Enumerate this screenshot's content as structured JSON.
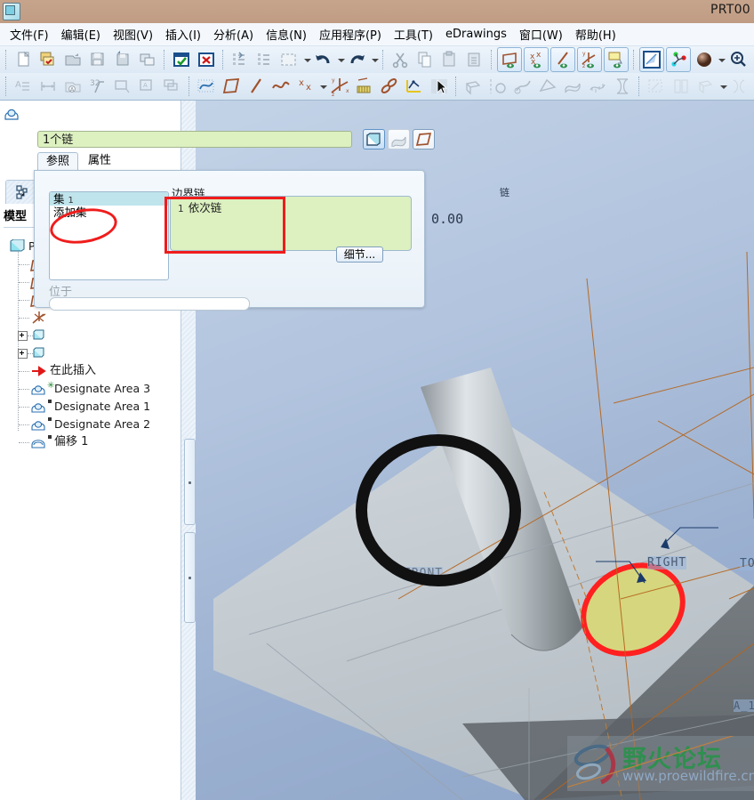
{
  "window": {
    "title": "PRT00",
    "app_icon": "part-document-icon"
  },
  "menubar": {
    "items": [
      {
        "label": "文件(F)",
        "name": "menu-file"
      },
      {
        "label": "编辑(E)",
        "name": "menu-edit"
      },
      {
        "label": "视图(V)",
        "name": "menu-view"
      },
      {
        "label": "插入(I)",
        "name": "menu-insert"
      },
      {
        "label": "分析(A)",
        "name": "menu-analysis"
      },
      {
        "label": "信息(N)",
        "name": "menu-info"
      },
      {
        "label": "应用程序(P)",
        "name": "menu-applications"
      },
      {
        "label": "工具(T)",
        "name": "menu-tools"
      },
      {
        "label": "eDrawings",
        "name": "menu-edrawings"
      },
      {
        "label": "窗口(W)",
        "name": "menu-window"
      },
      {
        "label": "帮助(H)",
        "name": "menu-help"
      }
    ]
  },
  "toolbar_row1": {
    "icons": [
      "new-file-icon",
      "open-recent-icon",
      "open-folder-icon",
      "save-icon",
      "save-a-copy-icon",
      "copy-window-icon",
      "accept-check-icon",
      "cancel-x-icon",
      "regenerate-icon",
      "regenerate-all-icon",
      "selection-box-icon",
      "undo-icon",
      "redo-icon",
      "cut-icon",
      "copy-icon",
      "paste-icon",
      "paste-special-icon",
      "datum-plane-icon",
      "datum-point-icon",
      "datum-axis-icon",
      "datum-csys-icon",
      "annotation-icon",
      "spin-center-icon",
      "named-view-icon",
      "appearance-sphere-icon",
      "zoom-in-icon"
    ]
  },
  "toolbar_row2": {
    "icons": [
      "text-style-icon",
      "dimension-icon",
      "view-note-icon",
      "tolerance-32-icon",
      "layer-icon",
      "layer-props-icon",
      "layer-copy-icon",
      "sketch-curve-icon",
      "plane-brown-icon",
      "axis-brown-icon",
      "curve-brown-icon",
      "point-brown-icon",
      "csys-brown-icon",
      "graph-icon",
      "chain-link-icon",
      "curve-yellow-icon",
      "pointer-icon",
      "extrude-icon",
      "revolve-icon",
      "sweep-icon",
      "blend-icon",
      "surface-icon",
      "mesh-icon",
      "shell-icon",
      "draft-icon",
      "rib-icon",
      "pattern-icon",
      "mirror-icon"
    ]
  },
  "model_tree": {
    "panel_tab_icon": "model-tree-icon",
    "title": "模型",
    "root": "PR",
    "nodes": [
      {
        "label": "",
        "icon": "datum-plane-icon",
        "indent": 1
      },
      {
        "label": "",
        "icon": "datum-plane-icon",
        "indent": 1
      },
      {
        "label": "",
        "icon": "datum-plane-icon",
        "indent": 1
      },
      {
        "label": "",
        "icon": "datum-csys-icon",
        "indent": 1
      },
      {
        "label": "",
        "icon": "solid-feature-icon",
        "indent": 1,
        "expandable": true
      },
      {
        "label": "",
        "icon": "solid-feature-icon",
        "indent": 1,
        "expandable": true
      },
      {
        "label": "在此插入",
        "icon": "insert-here-arrow-icon",
        "indent": 1
      },
      {
        "label": "Designate Area 3",
        "icon": "designate-area-icon",
        "indent": 1,
        "marker": "asterisk"
      },
      {
        "label": "Designate Area 1",
        "icon": "designate-area-icon",
        "indent": 1,
        "marker": "square"
      },
      {
        "label": "Designate Area 2",
        "icon": "designate-area-icon",
        "indent": 1,
        "marker": "square"
      },
      {
        "label": "偏移 1",
        "icon": "offset-feature-icon",
        "indent": 1,
        "marker": "square"
      }
    ]
  },
  "dashboard": {
    "chain_field_value": "1个链",
    "toggle_buttons": [
      {
        "name": "solid-surface-toggle",
        "icon": "solid-cube-icon",
        "state": "on"
      },
      {
        "name": "quilt-toggle",
        "icon": "quilt-surface-icon",
        "state": "disabled"
      },
      {
        "name": "datum-toggle",
        "icon": "plane-outline-icon",
        "state": "off"
      }
    ],
    "tabs": [
      {
        "label": "参照",
        "name": "tab-references",
        "active": true
      },
      {
        "label": "属性",
        "name": "tab-properties",
        "active": false
      }
    ],
    "set_list": {
      "rows": [
        {
          "text": "集",
          "num": "1",
          "selected": true
        },
        {
          "text": "添加集",
          "num": "",
          "selected": false
        }
      ]
    },
    "boundary_group": {
      "label": "边界链",
      "items": [
        {
          "num": "1",
          "text": "依次链"
        }
      ]
    },
    "detail_button": "细节...",
    "at_label": "位于",
    "at_value": ""
  },
  "annotations": {
    "red_marks": [
      {
        "name": "red-ellipse-add-set",
        "shape": "ellipse"
      },
      {
        "name": "red-box-boundary-chain",
        "shape": "rect"
      }
    ],
    "black_circle": {
      "name": "black-circle-highlight"
    }
  },
  "viewport": {
    "dimension_value": "0.00",
    "chain_callout": "链",
    "plane_labels": [
      {
        "text": "RIGHT",
        "name": "plane-label-right"
      },
      {
        "text": "FRONT",
        "name": "plane-label-front"
      },
      {
        "text": "A_1",
        "name": "axis-label-a1"
      },
      {
        "text": "TOP",
        "name": "plane-label-top"
      }
    ],
    "triad": {
      "x_color": "#e02020",
      "y_color": "#20c020",
      "z_color": "#20d8e8"
    }
  },
  "watermark": {
    "cn_text": "野火论坛",
    "url_text": "www.proewildfire.cn",
    "logo": "wildfire-forum-logo"
  },
  "colors": {
    "titlebar": "#c09c84",
    "field_green": "#dcf0c0",
    "selection_cyan": "#bfe4ec",
    "red_annotation": "#f01c1c",
    "highlight_red": "#ff2020",
    "surface_yellow": "#d8d87a"
  }
}
